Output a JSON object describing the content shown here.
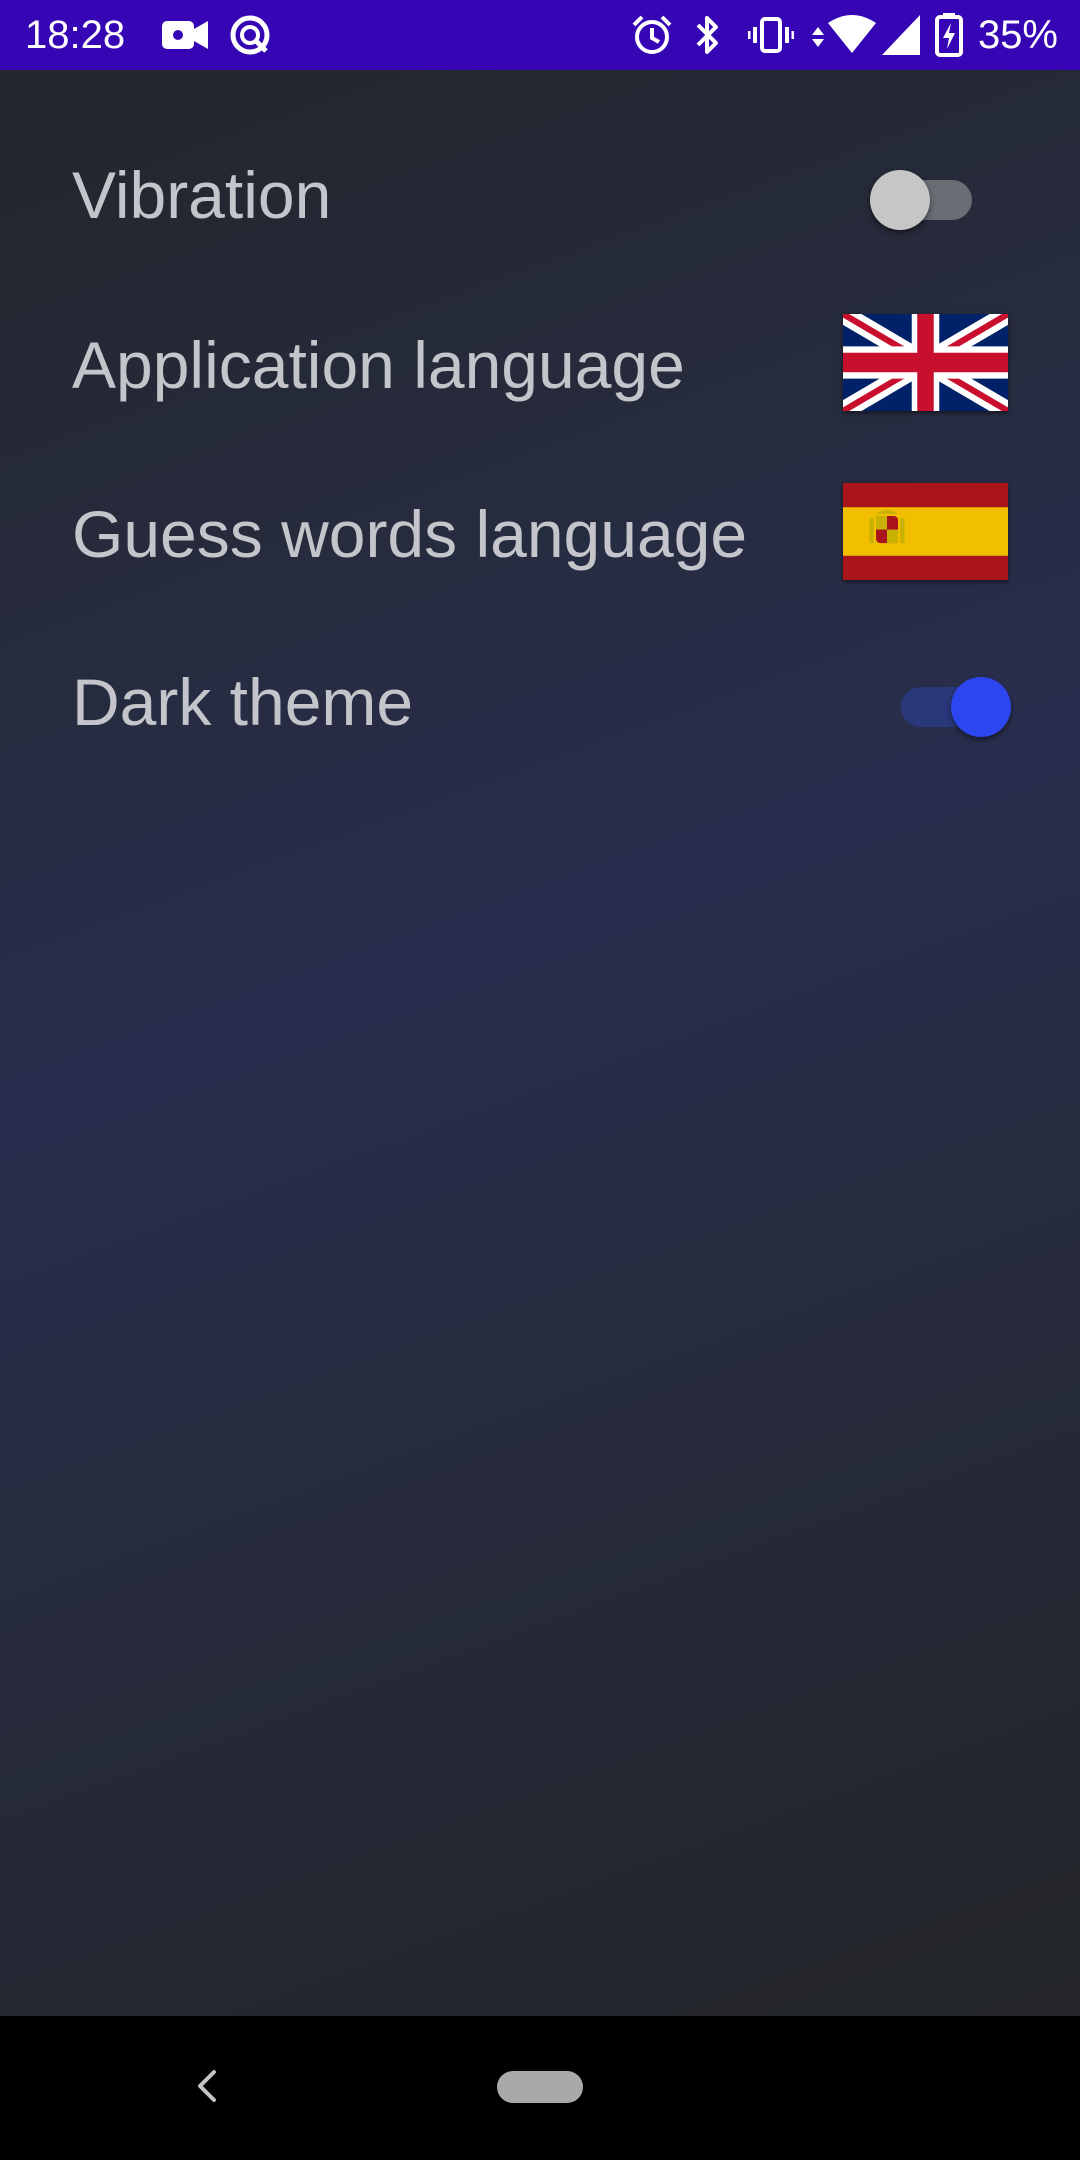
{
  "status_bar": {
    "time": "18:28",
    "battery_percent": "35%",
    "background_color": "#3606b4",
    "left_icons": [
      "video-camera-icon",
      "data-saver-icon"
    ],
    "right_icons": [
      "alarm-icon",
      "bluetooth-icon",
      "vibrate-icon",
      "wifi-icon",
      "cellular-signal-icon",
      "battery-charging-icon"
    ]
  },
  "settings": {
    "vibration": {
      "label": "Vibration",
      "enabled": false
    },
    "app_language": {
      "label": "Application language",
      "flag": "uk-flag-icon"
    },
    "guess_language": {
      "label": "Guess words language",
      "flag": "spain-flag-icon"
    },
    "dark_theme": {
      "label": "Dark theme",
      "enabled": true
    }
  },
  "colors": {
    "label_text": "#c3c5ca",
    "switch_on_thumb": "#2c46f0",
    "switch_on_track": "#29387a",
    "switch_off_thumb": "#c6c6c6",
    "switch_off_track": "#6b6d75"
  },
  "navigation_bar": {
    "buttons": [
      "back-icon",
      "home-pill-icon"
    ]
  }
}
